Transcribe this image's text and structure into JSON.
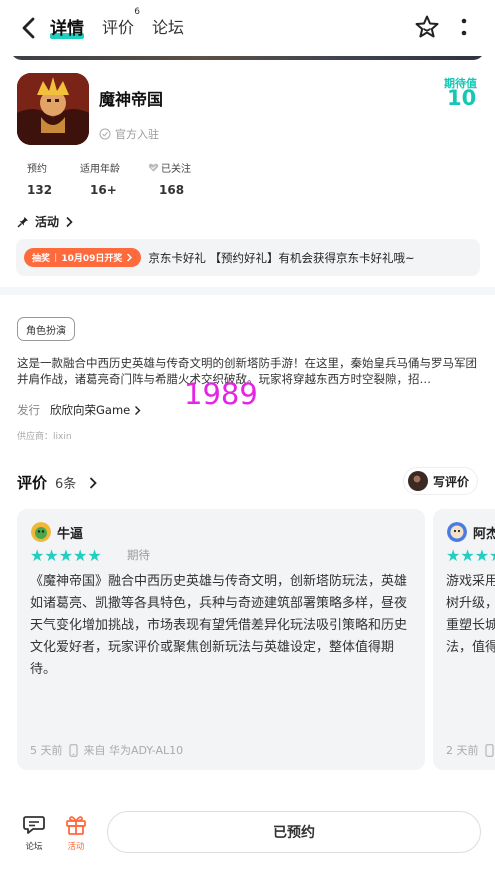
{
  "header": {
    "tabs": [
      {
        "label": "详情",
        "active": true
      },
      {
        "label": "评价",
        "badge": "6"
      },
      {
        "label": "论坛"
      }
    ]
  },
  "app": {
    "name": "魔神帝国",
    "official_label": "官方入驻",
    "expect_label": "期待值",
    "expect_value": "10"
  },
  "stats": [
    {
      "label": "预约",
      "value": "132"
    },
    {
      "label": "适用年龄",
      "value": "16+"
    },
    {
      "label": "已关注",
      "value": "168"
    }
  ],
  "activity": {
    "link_label": "活动",
    "badge_left": "抽奖",
    "badge_right": "10月09日开奖",
    "text": "京东卡好礼 【预约好礼】有机会获得京东卡好礼哦~"
  },
  "details": {
    "genre_tag": "角色扮演",
    "description": "这是一款融合中西历史英雄与传奇文明的创新塔防手游！在这里，秦始皇兵马俑与罗马军团并肩作战，诸葛亮奇门阵与希腊火术交织破敌。玩家将穿越东西方时空裂隙，招…",
    "publisher_label": "发行",
    "publisher_name": "欣欣向荣Game",
    "supplier": "供应商：lixin",
    "watermark": "1989"
  },
  "reviews": {
    "title": "评价",
    "count": "6条",
    "write_label": "写评价",
    "cards": [
      {
        "user": "牛逼",
        "tag": "期待",
        "stars": "★★★★★",
        "text": "《魔神帝国》融合中西历史英雄与传奇文明，创新塔防玩法，英雄如诸葛亮、凯撒等各具特色，兵种与奇迹建筑部署策略多样，昼夜天气变化增加挑战，市场表现有望凭借差异化玩法吸引策略和历史文化爱好者，玩家评价或聚焦创新玩法与英雄设定，整体值得期待。",
        "time": "5 天前",
        "device": "来自 华为ADY-AL10"
      },
      {
        "user": "阿杰",
        "tag": "",
        "stars": "★★★★★",
        "text": "游戏采用树升级，重塑长城法，值得",
        "time": "2 天前",
        "device": ""
      }
    ]
  },
  "bottom": {
    "forum_label": "论坛",
    "activity_label": "活动",
    "reserve_label": "已预约"
  },
  "colors": {
    "accent": "#1fd0c0",
    "orange": "#ff6a3d"
  }
}
